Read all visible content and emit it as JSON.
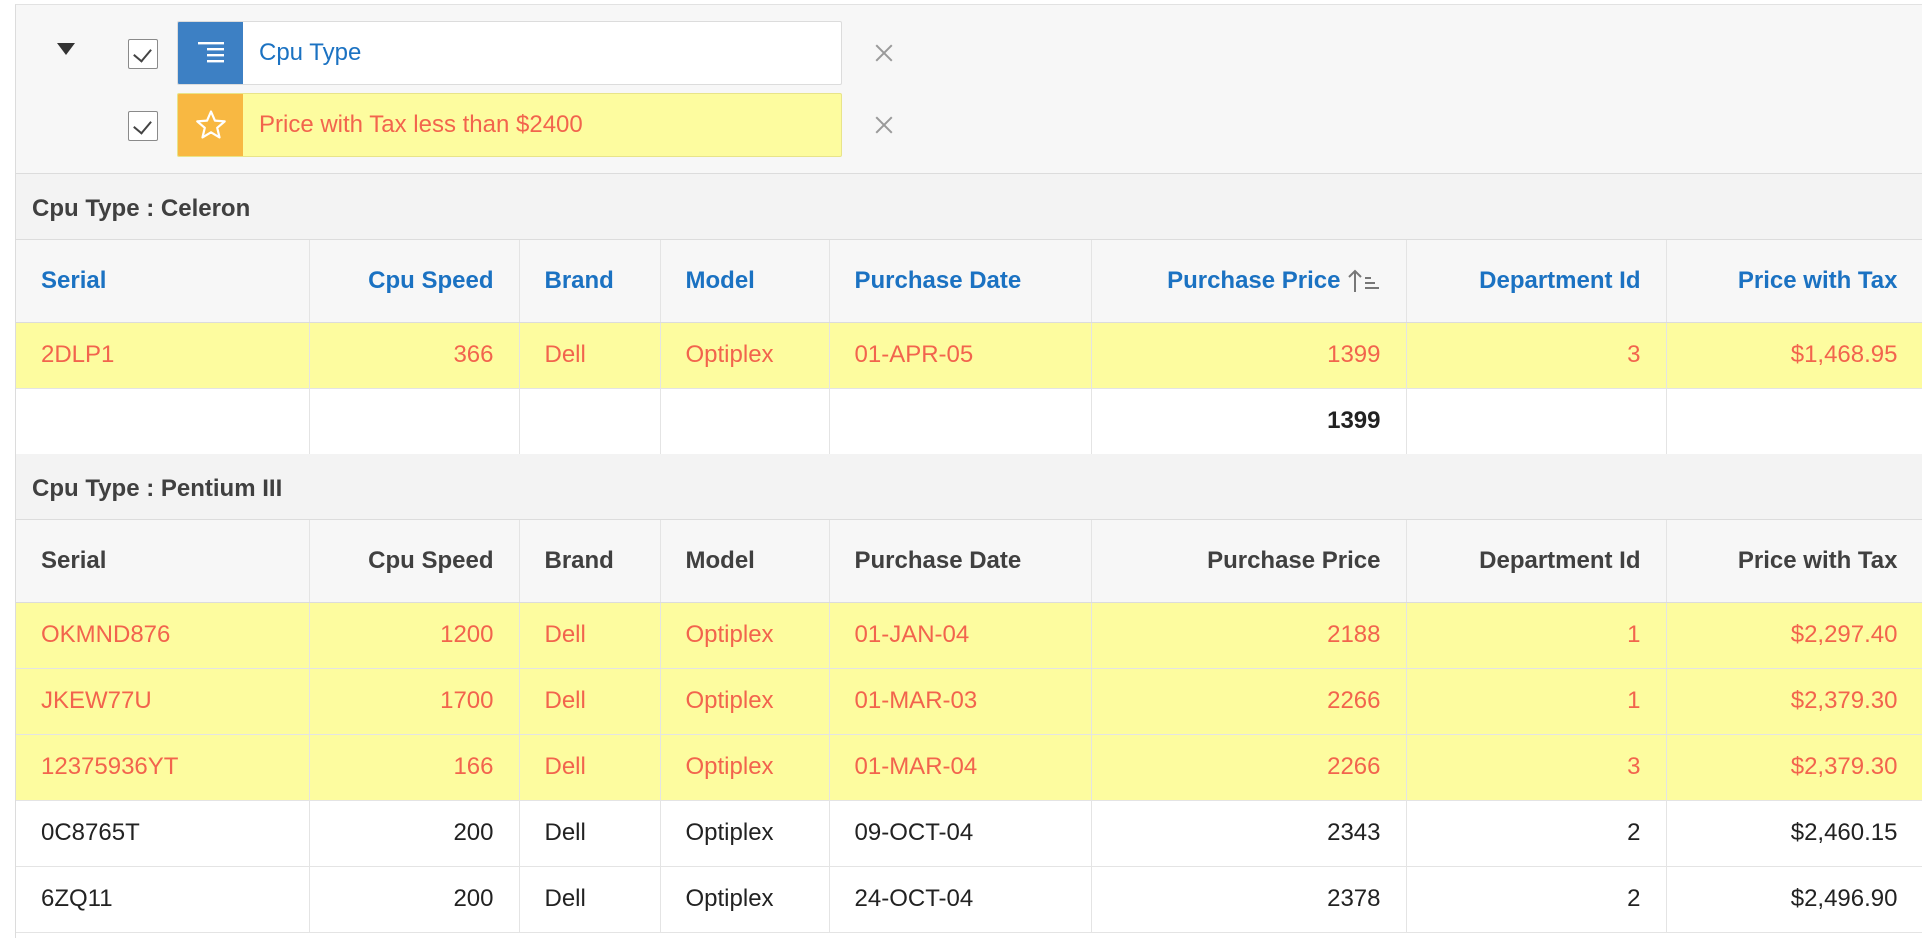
{
  "filters": [
    {
      "label": "Cpu Type",
      "type": "control-break",
      "icon": "control-break-icon",
      "enabled": true
    },
    {
      "label": "Price with Tax less than $2400",
      "type": "highlight",
      "icon": "star-icon",
      "enabled": true
    }
  ],
  "columns": [
    "Serial",
    "Cpu Speed",
    "Brand",
    "Model",
    "Purchase Date",
    "Purchase Price",
    "Department Id",
    "Price with Tax"
  ],
  "groups": [
    {
      "header": "Cpu Type : Celeron",
      "rows": [
        {
          "highlight": true,
          "cells": [
            "2DLP1",
            "366",
            "Dell",
            "Optiplex",
            "01-APR-05",
            "1399",
            "3",
            "$1,468.95"
          ]
        }
      ],
      "total": [
        "",
        "",
        "",
        "",
        "",
        "1399",
        "",
        ""
      ]
    },
    {
      "header": "Cpu Type : Pentium III",
      "rows": [
        {
          "highlight": true,
          "cells": [
            "OKMND876",
            "1200",
            "Dell",
            "Optiplex",
            "01-JAN-04",
            "2188",
            "1",
            "$2,297.40"
          ]
        },
        {
          "highlight": true,
          "cells": [
            "JKEW77U",
            "1700",
            "Dell",
            "Optiplex",
            "01-MAR-03",
            "2266",
            "1",
            "$2,379.30"
          ]
        },
        {
          "highlight": true,
          "cells": [
            "12375936YT",
            "166",
            "Dell",
            "Optiplex",
            "01-MAR-04",
            "2266",
            "3",
            "$2,379.30"
          ]
        },
        {
          "highlight": false,
          "cells": [
            "0C8765T",
            "200",
            "Dell",
            "Optiplex",
            "09-OCT-04",
            "2343",
            "2",
            "$2,460.15"
          ]
        },
        {
          "highlight": false,
          "cells": [
            "6ZQ11",
            "200",
            "Dell",
            "Optiplex",
            "24-OCT-04",
            "2378",
            "2",
            "$2,496.90"
          ]
        }
      ]
    }
  ],
  "colors": {
    "link_blue": "#1b72c2",
    "highlight_bg": "#fdfc9f",
    "highlight_text": "#f2644d",
    "control_break_icon_bg": "#3d80c4",
    "highlight_icon_bg": "#f8b842"
  }
}
